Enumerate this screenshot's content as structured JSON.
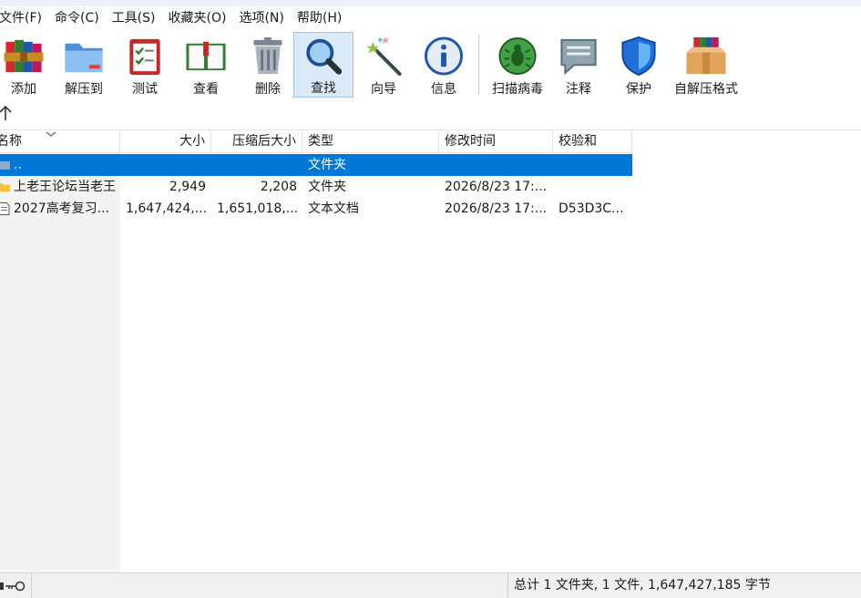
{
  "menu": [
    "文件(F)",
    "命令(C)",
    "工具(S)",
    "收藏夹(O)",
    "选项(N)",
    "帮助(H)"
  ],
  "toolbar": {
    "add": "添加",
    "extract": "解压到",
    "test": "测试",
    "view": "查看",
    "delete": "删除",
    "find": "查找",
    "wizard": "向导",
    "info": "信息",
    "scan": "扫描病毒",
    "comment": "注释",
    "protect": "保护",
    "sfx": "自解压格式"
  },
  "columns": {
    "name": "名称",
    "size": "大小",
    "packed": "压缩后大小",
    "type": "类型",
    "modified": "修改时间",
    "crc": "校验和"
  },
  "rows": [
    {
      "name": "..",
      "size": "",
      "packed": "",
      "type": "文件夹",
      "modified": "",
      "crc": ""
    },
    {
      "name": "上老王论坛当老王",
      "size": "2,949",
      "packed": "2,208",
      "type": "文件夹",
      "modified": "2026/8/23 17:...",
      "crc": ""
    },
    {
      "name": "2027高考复习...",
      "size": "1,647,424,...",
      "packed": "1,651,018,...",
      "type": "文本文档",
      "modified": "2026/8/23 17:...",
      "crc": "D53D3C..."
    }
  ],
  "status": {
    "summary": "总计 1 文件夹, 1 文件, 1,647,427,185 字节"
  },
  "colors": {
    "selection": "#0078d7",
    "active_tool_bg": "#dbeaf9"
  },
  "icons": {
    "add": "rar-books-icon",
    "extract": "folder-icon",
    "test": "checklist-icon",
    "view": "book-icon",
    "delete": "trash-icon",
    "find": "magnifier-icon",
    "wizard": "magic-wand-icon",
    "info": "info-icon",
    "scan": "virus-scan-icon",
    "comment": "comment-icon",
    "protect": "shield-icon",
    "sfx": "sfx-box-icon"
  }
}
